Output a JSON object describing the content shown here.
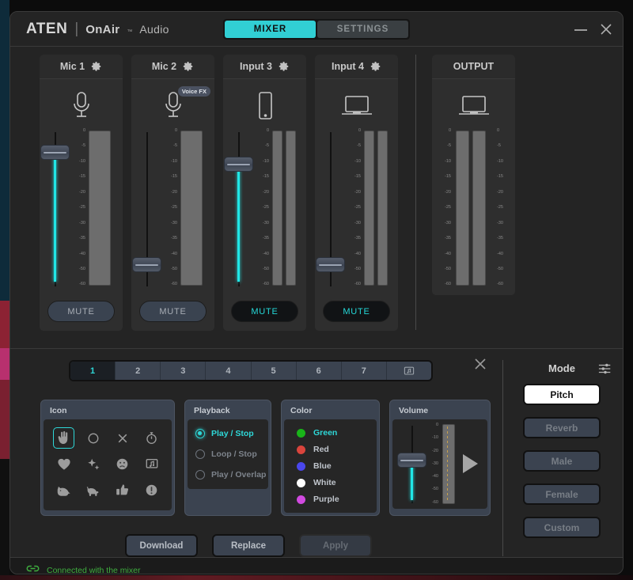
{
  "window": {
    "brand_aten": "ATEN",
    "brand_separator": "|",
    "brand_onair": "OnAir",
    "brand_tm": "™",
    "brand_audio": "Audio",
    "minimize_icon": "minimize-icon",
    "close_icon": "close-icon"
  },
  "tabs": [
    {
      "label": "MIXER",
      "active": true
    },
    {
      "label": "SETTINGS",
      "active": false
    }
  ],
  "mixer": {
    "scale_ticks": [
      "0",
      "-5",
      "-10",
      "-15",
      "-20",
      "-25",
      "-30",
      "-35",
      "-40",
      "-50",
      "-60"
    ],
    "channels": [
      {
        "title": "Mic 1",
        "gear_icon": "gear-icon",
        "device_icon": "microphone-icon",
        "badge": null,
        "fader_value": "-3",
        "fader_pos_pct": 4,
        "fill": true,
        "meters": 1,
        "mute_label": "MUTE",
        "muted": false
      },
      {
        "title": "Mic 2",
        "gear_icon": "gear-icon",
        "device_icon": "microphone-icon",
        "badge": "Voice FX",
        "fader_value": "-60",
        "fader_pos_pct": 84,
        "fill": false,
        "meters": 1,
        "mute_label": "MUTE",
        "muted": false
      },
      {
        "title": "Input 3",
        "gear_icon": "gear-icon",
        "device_icon": "smartphone-icon",
        "badge": null,
        "fader_value": "-8",
        "fader_pos_pct": 12,
        "fill": true,
        "meters": 2,
        "mute_label": "MUTE",
        "muted": true
      },
      {
        "title": "Input 4",
        "gear_icon": "gear-icon",
        "device_icon": "laptop-icon",
        "badge": null,
        "fader_value": "-60",
        "fader_pos_pct": 84,
        "fill": false,
        "meters": 2,
        "mute_label": "MUTE",
        "muted": true
      }
    ],
    "output": {
      "title": "OUTPUT",
      "device_icon": "laptop-icon",
      "meters": 2
    }
  },
  "sound_panel": {
    "close_icon": "close-icon",
    "number_tabs": [
      {
        "label": "1",
        "active": true
      },
      {
        "label": "2",
        "active": false
      },
      {
        "label": "3",
        "active": false
      },
      {
        "label": "4",
        "active": false
      },
      {
        "label": "5",
        "active": false
      },
      {
        "label": "6",
        "active": false
      },
      {
        "label": "7",
        "active": false
      },
      {
        "label": "",
        "icon": "music-note-screen-icon",
        "active": false
      }
    ],
    "icon_panel": {
      "title": "Icon",
      "icons": [
        {
          "name": "clap-hand-icon",
          "selected": true
        },
        {
          "name": "circle-icon",
          "selected": false
        },
        {
          "name": "cross-icon",
          "selected": false
        },
        {
          "name": "stopwatch-icon",
          "selected": false
        },
        {
          "name": "heart-icon",
          "selected": false
        },
        {
          "name": "sparkles-icon",
          "selected": false
        },
        {
          "name": "sad-face-icon",
          "selected": false
        },
        {
          "name": "music-note-screen-icon",
          "selected": false
        },
        {
          "name": "cat-icon",
          "selected": false
        },
        {
          "name": "dog-icon",
          "selected": false
        },
        {
          "name": "thumbs-up-icon",
          "selected": false
        },
        {
          "name": "exclamation-icon",
          "selected": false
        }
      ]
    },
    "playback_panel": {
      "title": "Playback",
      "options": [
        {
          "label": "Play / Stop",
          "selected": true
        },
        {
          "label": "Loop / Stop",
          "selected": false
        },
        {
          "label": "Play / Overlap",
          "selected": false
        }
      ]
    },
    "color_panel": {
      "title": "Color",
      "options": [
        {
          "label": "Green",
          "hex": "#19b419",
          "selected": true
        },
        {
          "label": "Red",
          "hex": "#d9443c",
          "selected": false
        },
        {
          "label": "Blue",
          "hex": "#4a47ec",
          "selected": false
        },
        {
          "label": "White",
          "hex": "#ffffff",
          "selected": false
        },
        {
          "label": "Purple",
          "hex": "#d14ae0",
          "selected": false
        }
      ]
    },
    "volume_panel": {
      "title": "Volume",
      "scale_ticks": [
        "0",
        "-10",
        "-20",
        "-30",
        "-40",
        "-50",
        "-60"
      ],
      "fader_value": "-30",
      "fader_pos_pct": 42,
      "play_icon": "play-icon"
    },
    "actions": [
      {
        "label": "Download",
        "enabled": true
      },
      {
        "label": "Replace",
        "enabled": true
      },
      {
        "label": "Apply",
        "enabled": false
      }
    ]
  },
  "mode_panel": {
    "title": "Mode",
    "sliders_icon": "sliders-icon",
    "buttons": [
      {
        "label": "Pitch",
        "active": true
      },
      {
        "label": "Reverb",
        "active": false
      },
      {
        "label": "Male",
        "active": false
      },
      {
        "label": "Female",
        "active": false
      },
      {
        "label": "Custom",
        "active": false
      }
    ]
  },
  "statusbar": {
    "link_icon": "link-icon",
    "text": "Connected with the mixer",
    "color": "#3fae3f"
  }
}
